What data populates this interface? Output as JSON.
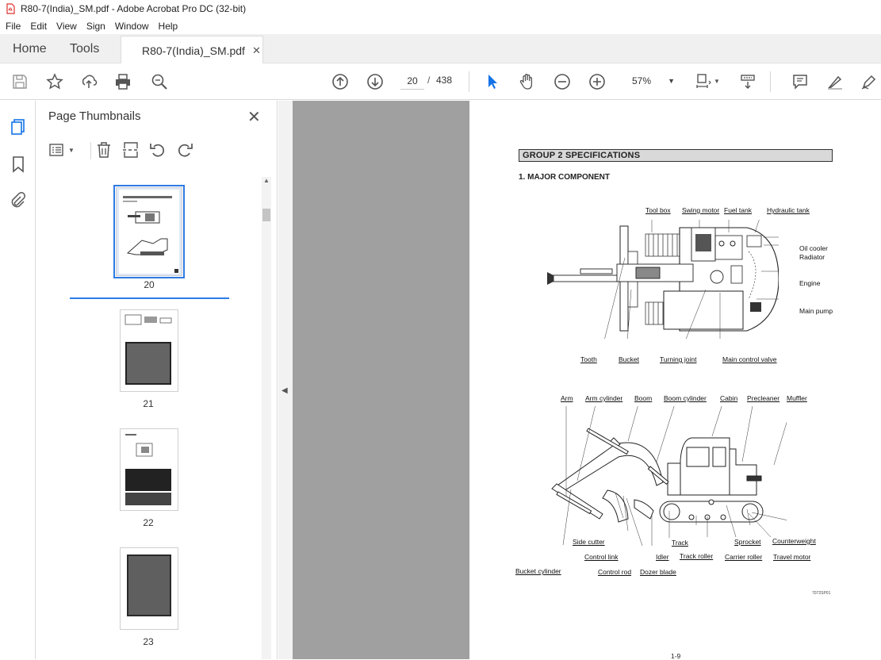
{
  "window": {
    "title": "R80-7(India)_SM.pdf - Adobe Acrobat Pro DC (32-bit)"
  },
  "menu": [
    "File",
    "Edit",
    "View",
    "Sign",
    "Window",
    "Help"
  ],
  "tabs": {
    "home": "Home",
    "tools": "Tools",
    "document": "R80-7(India)_SM.pdf"
  },
  "toolbar": {
    "page_current": "20",
    "page_separator": "/",
    "page_total": "438",
    "zoom": "57%"
  },
  "panel": {
    "title": "Page Thumbnails",
    "thumbnails": [
      {
        "label": "20",
        "selected": true
      },
      {
        "label": "21",
        "selected": false
      },
      {
        "label": "22",
        "selected": false
      },
      {
        "label": "23",
        "selected": false
      }
    ]
  },
  "document": {
    "group_header": "GROUP  2  SPECIFICATIONS",
    "section_heading": "1.  MAJOR COMPONENT",
    "top_view_labels": {
      "tool_box": "Tool box",
      "swing_motor": "Swing motor",
      "fuel_tank": "Fuel tank",
      "hydraulic_tank": "Hydraulic tank",
      "oil_cooler": "Oil cooler",
      "radiator": "Radiator",
      "engine": "Engine",
      "main_pump": "Main pump",
      "tooth": "Tooth",
      "bucket": "Bucket",
      "turning_joint": "Turning joint",
      "main_control_valve": "Main control valve"
    },
    "side_view_labels": {
      "arm": "Arm",
      "arm_cylinder": "Arm cylinder",
      "boom": "Boom",
      "boom_cylinder": "Boom cylinder",
      "cabin": "Cabin",
      "precleaner": "Precleaner",
      "muffler": "Muffler",
      "side_cutter": "Side cutter",
      "control_link": "Control link",
      "bucket_cylinder": "Bucket cylinder",
      "control_rod": "Control rod",
      "dozer_blade": "Dozer blade",
      "idler": "Idler",
      "track": "Track",
      "track_roller": "Track roller",
      "carrier_roller": "Carrier roller",
      "sprocket": "Sprocket",
      "travel_motor": "Travel motor",
      "counterweight": "Counterweight"
    },
    "figure_code": "7072SP01",
    "page_number": "1-9"
  },
  "colors": {
    "accent": "#2d7be5",
    "pdf_icon": "#e0302d",
    "cursor": "#1473e6"
  }
}
